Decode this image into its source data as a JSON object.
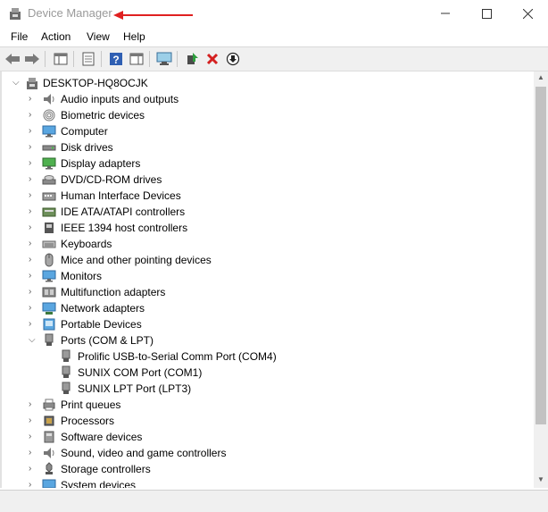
{
  "window": {
    "title": "Device Manager",
    "controls": [
      "minimize",
      "maximize",
      "close"
    ]
  },
  "menu": [
    "File",
    "Action",
    "View",
    "Help"
  ],
  "toolbar": [
    "back-arrow",
    "forward-arrow",
    "show-hide-console-tree",
    "properties",
    "help",
    "action-pane",
    "scan-hardware",
    "update-driver",
    "uninstall-device",
    "disable-device"
  ],
  "tree": {
    "root": "DESKTOP-HQ8OCJK",
    "categories": [
      {
        "label": "Audio inputs and outputs",
        "icon": "speaker-icon"
      },
      {
        "label": "Biometric devices",
        "icon": "fingerprint-icon"
      },
      {
        "label": "Computer",
        "icon": "monitor-icon"
      },
      {
        "label": "Disk drives",
        "icon": "disk-drive-icon"
      },
      {
        "label": "Display adapters",
        "icon": "display-adapter-icon"
      },
      {
        "label": "DVD/CD-ROM drives",
        "icon": "dvd-drive-icon"
      },
      {
        "label": "Human Interface Devices",
        "icon": "hid-icon"
      },
      {
        "label": "IDE ATA/ATAPI controllers",
        "icon": "ide-controller-icon"
      },
      {
        "label": "IEEE 1394 host controllers",
        "icon": "ieee1394-icon"
      },
      {
        "label": "Keyboards",
        "icon": "keyboard-icon"
      },
      {
        "label": "Mice and other pointing devices",
        "icon": "mouse-icon"
      },
      {
        "label": "Monitors",
        "icon": "monitor-icon"
      },
      {
        "label": "Multifunction adapters",
        "icon": "multifunction-icon"
      },
      {
        "label": "Network adapters",
        "icon": "network-icon"
      },
      {
        "label": "Portable Devices",
        "icon": "portable-device-icon"
      },
      {
        "label": "Ports (COM & LPT)",
        "icon": "port-icon",
        "expanded": true,
        "children": [
          {
            "label": "Prolific USB-to-Serial Comm Port (COM4)",
            "icon": "port-icon"
          },
          {
            "label": "SUNIX COM Port (COM1)",
            "icon": "port-icon"
          },
          {
            "label": "SUNIX LPT Port (LPT3)",
            "icon": "port-icon"
          }
        ]
      },
      {
        "label": "Print queues",
        "icon": "printer-icon"
      },
      {
        "label": "Processors",
        "icon": "processor-icon"
      },
      {
        "label": "Software devices",
        "icon": "software-device-icon"
      },
      {
        "label": "Sound, video and game controllers",
        "icon": "speaker-icon"
      },
      {
        "label": "Storage controllers",
        "icon": "storage-controller-icon"
      },
      {
        "label": "System devices",
        "icon": "system-device-icon"
      }
    ]
  },
  "colors": {
    "annotation": "#e02020",
    "title_text": "#9a9a9a",
    "accent": "#3a7bd5"
  }
}
